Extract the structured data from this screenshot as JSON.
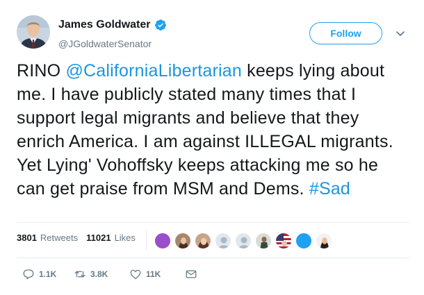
{
  "user": {
    "display_name": "James Goldwater",
    "handle": "@JGoldwaterSenator",
    "verified": true
  },
  "follow_label": "Follow",
  "tweet": {
    "lead": "RINO ",
    "mention": "@CaliforniaLibertarian",
    "body": " keeps lying about me. I have publicly stated many times that I support legal migrants and believe that they enrich America. I am against ILLEGAL migrants. Yet Lying' Vohoffsky keeps attacking me so he can get praise from MSM and Dems. ",
    "hashtag": "#Sad"
  },
  "stats": {
    "retweets_count": "3801",
    "retweets_label": "Retweets",
    "likes_count": "11021",
    "likes_label": "Likes"
  },
  "likers": [
    "purple-avatar",
    "woman-avatar",
    "woman-avatar",
    "default-avatar",
    "default-avatar",
    "person-avatar",
    "flag-avatar",
    "blue-avatar",
    "woman-avatar"
  ],
  "actions": {
    "replies": "1.1K",
    "retweets": "3.8K",
    "likes": "11K"
  },
  "colors": {
    "link": "#1b95e0",
    "follow": "#1da1f2",
    "muted": "#657786"
  }
}
